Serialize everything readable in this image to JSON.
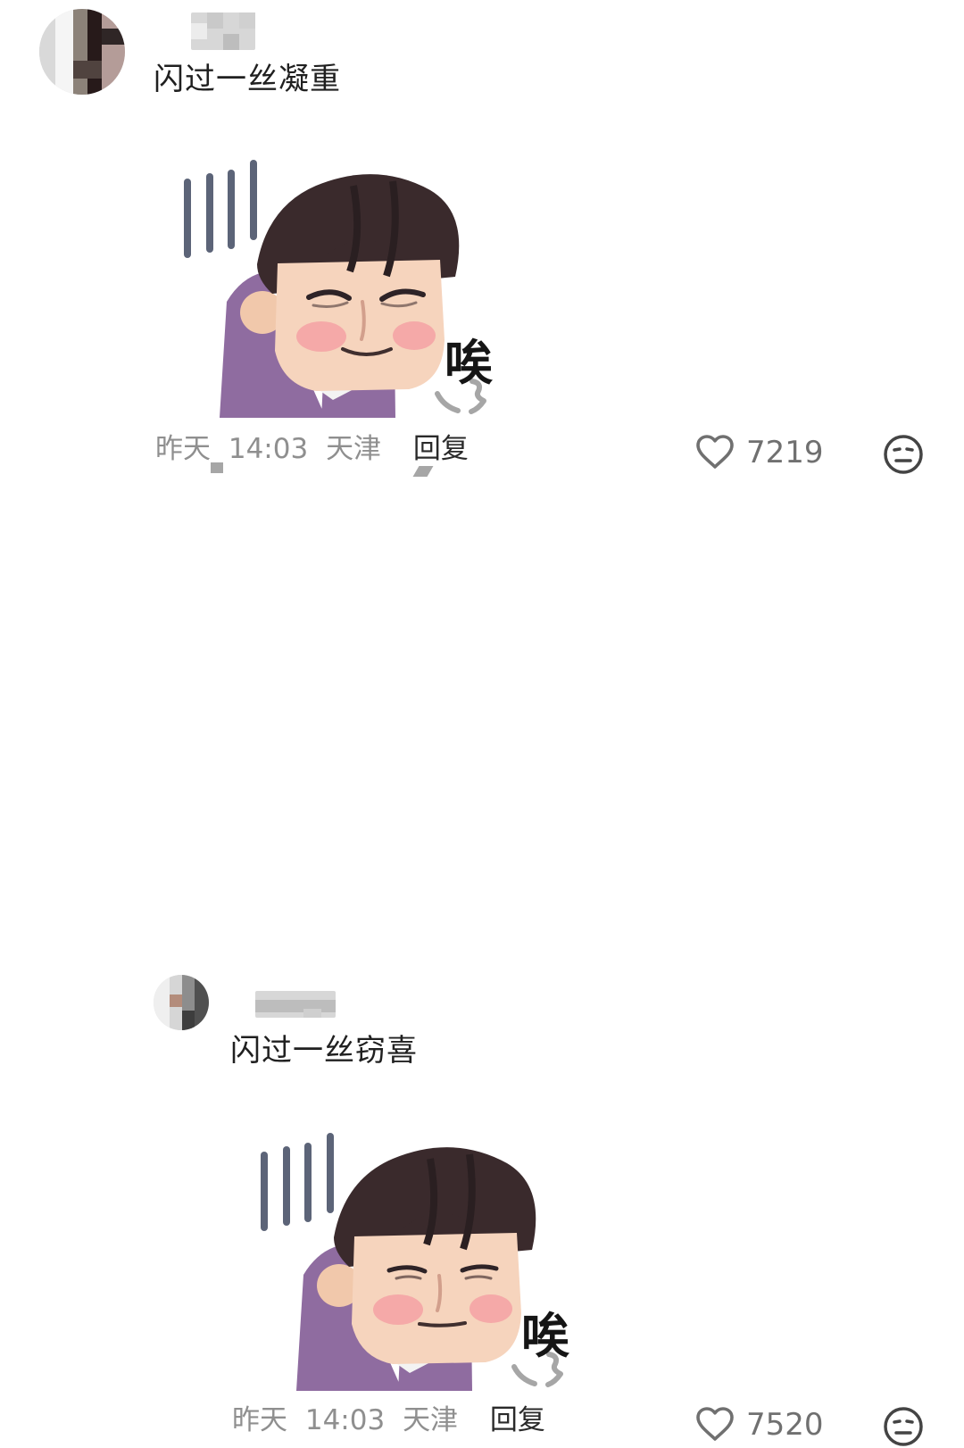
{
  "comments": [
    {
      "text": "闪过一丝凝重",
      "meta": {
        "date": "昨天",
        "time": "14:03",
        "location": "天津",
        "reply_label": "回复"
      },
      "like_count": "7219",
      "sticker": {
        "caption": "唉"
      }
    },
    {
      "text": "闪过一丝窃喜",
      "meta": {
        "date": "昨天",
        "time": "14:03",
        "location": "天津",
        "reply_label": "回复"
      },
      "like_count": "7520",
      "sticker": {
        "caption": "唉"
      }
    }
  ],
  "icons": {
    "heart": "heart-icon",
    "emoji": "neutral-face-icon"
  },
  "colors": {
    "text_primary": "#202020",
    "text_secondary": "#8f8f8f",
    "icon_gray": "#707070",
    "hair": "#3a2a2c",
    "shirt": "#8f6ca0",
    "skin": "#f6d4bd",
    "blush": "#f4a7a7",
    "motion_lines": "#5c6478"
  }
}
